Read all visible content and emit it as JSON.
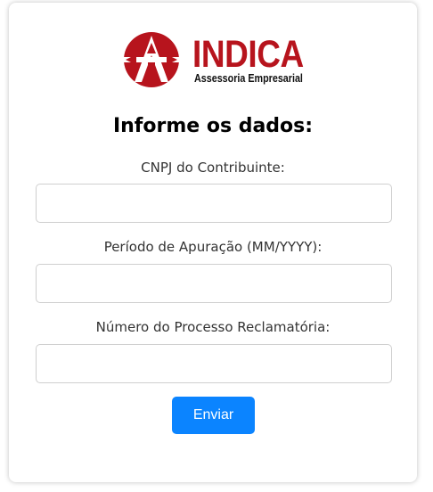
{
  "brand": {
    "name": "INDICA",
    "tagline": "Assessoria Empresarial",
    "logo_icon": "indica-logo-icon",
    "color": "#b7141d"
  },
  "form": {
    "title": "Informe os dados:",
    "fields": [
      {
        "label": "CNPJ do Contribuinte:",
        "value": "",
        "placeholder": ""
      },
      {
        "label": "Período de Apuração (MM/YYYY):",
        "value": "",
        "placeholder": ""
      },
      {
        "label": "Número do Processo Reclamatória:",
        "value": "",
        "placeholder": ""
      }
    ],
    "submit_label": "Enviar",
    "submit_color": "#0b84ff"
  }
}
